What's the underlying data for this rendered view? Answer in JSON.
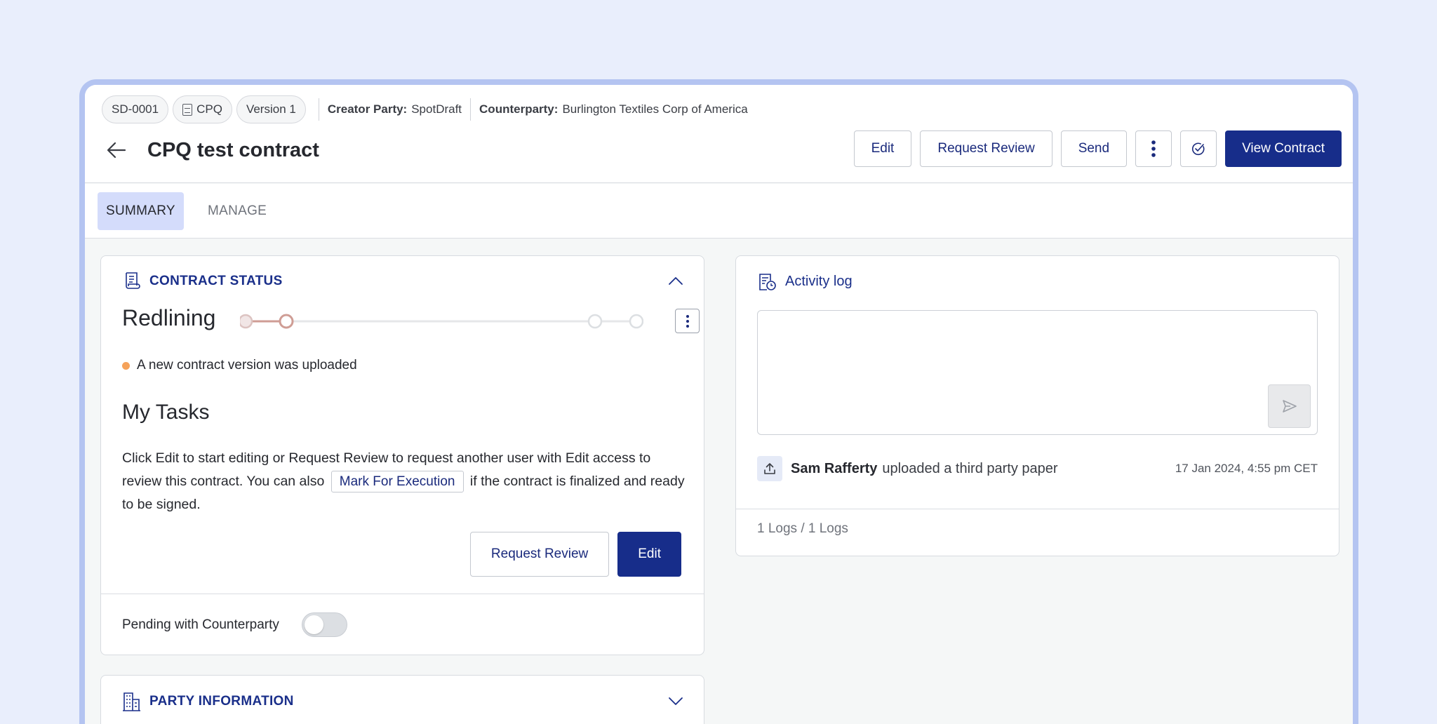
{
  "header": {
    "chips": {
      "id": "SD-0001",
      "type": "CPQ",
      "version": "Version 1"
    },
    "creator_party": {
      "label": "Creator Party:",
      "value": "SpotDraft"
    },
    "counterparty": {
      "label": "Counterparty:",
      "value": "Burlington Textiles Corp of America"
    },
    "title": "CPQ test contract",
    "actions": {
      "edit": "Edit",
      "request_review": "Request Review",
      "send": "Send",
      "view_contract": "View Contract"
    }
  },
  "tabs": [
    {
      "label": "SUMMARY",
      "active": true
    },
    {
      "label": "MANAGE",
      "active": false
    }
  ],
  "contract_status": {
    "heading": "CONTRACT STATUS",
    "stage": "Redlining",
    "stage_progress": "2 of 4",
    "note": "A new contract version was uploaded",
    "note_color": "#f5a25a",
    "tasks_title": "My Tasks",
    "tasks_text_before": "Click Edit to start editing or Request Review to request another user with Edit access to review this contract. You can also",
    "tasks_inline_button": "Mark For Execution",
    "tasks_text_after": "if the contract is finalized and ready to be signed.",
    "request_review_button": "Request Review",
    "edit_button": "Edit",
    "pending_label": "Pending with Counterparty",
    "pending_toggle": false
  },
  "party_information": {
    "heading": "PARTY INFORMATION"
  },
  "activity_log": {
    "heading": "Activity log",
    "comment_value": "",
    "entries": [
      {
        "user": "Sam Rafferty",
        "action": "uploaded a third party paper",
        "time": "17 Jan 2024, 4:55 pm CET",
        "icon": "upload-icon"
      }
    ],
    "count": "1 Logs / 1 Logs"
  },
  "colors": {
    "primary": "#172d8a",
    "accent_text": "#1a2f8a",
    "background": "#e9eefc",
    "frame": "#b4c4f1",
    "tab_active": "#d4dcfb"
  }
}
